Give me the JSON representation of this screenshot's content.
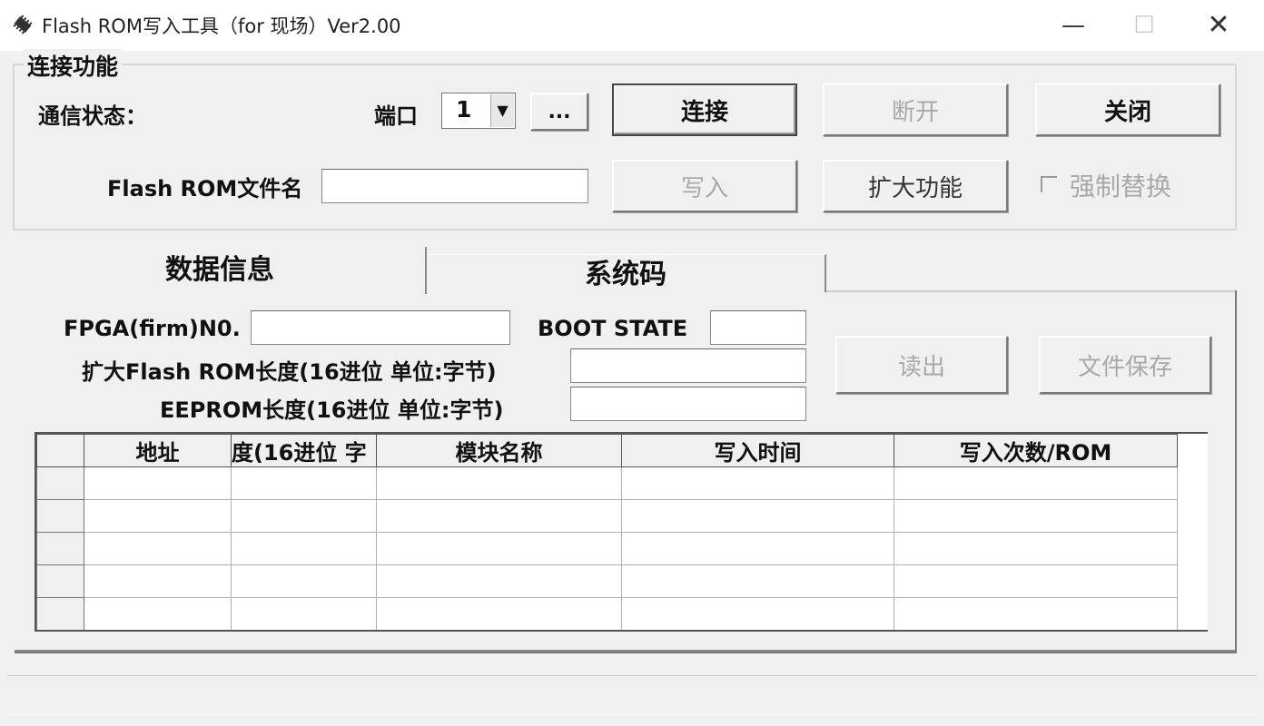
{
  "window": {
    "title": "Flash ROM写入工具（for 现场）Ver2.00",
    "minimize": "—",
    "maximize": "☐",
    "close": "✕"
  },
  "connection": {
    "legend": "连接功能",
    "status_label": "通信状态：",
    "port_label": "端口",
    "port_value": "1",
    "browse_label": "...",
    "connect_label": "连接",
    "disconnect_label": "断开",
    "close_label": "关闭",
    "file_label": "Flash ROM文件名",
    "file_value": "",
    "write_label": "写入",
    "extend_label": "扩大功能",
    "force_replace_label": "强制替换"
  },
  "tabs": [
    {
      "label": "数据信息"
    },
    {
      "label": "系统码"
    }
  ],
  "info": {
    "fpga_label": "FPGA(firm)N0.",
    "fpga_value": "",
    "boot_label": "BOOT STATE",
    "boot_value": "",
    "ext_len_label": "扩大Flash ROM长度(16进位 单位:字节)",
    "ext_len_value": "",
    "eeprom_len_label": "EEPROM长度(16进位 单位:字节)",
    "eeprom_len_value": "",
    "read_label": "读出",
    "save_label": "文件保存"
  },
  "grid": {
    "columns": [
      "地址",
      "度(16进位 字",
      "模块名称",
      "写入时间",
      "写入次数/ROM"
    ],
    "row_count": 5
  },
  "colors": {
    "window_bg": "#f0f0f0",
    "disabled_text": "#a9a9a9"
  }
}
